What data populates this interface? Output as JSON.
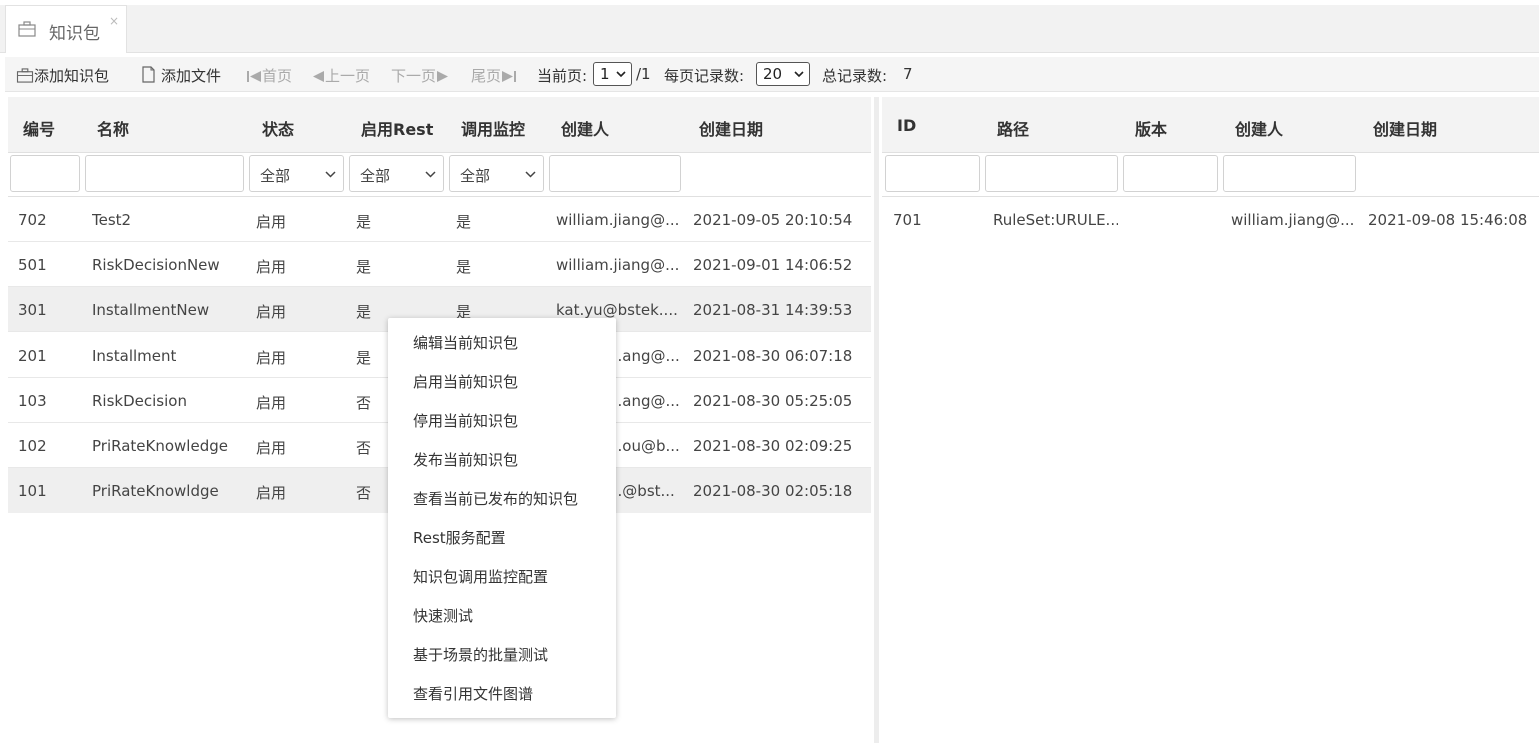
{
  "tab": {
    "title": "知识包",
    "close": "×",
    "icon": "briefcase-icon"
  },
  "toolbar": {
    "add_package": "添加知识包",
    "add_file": "添加文件",
    "first": "首页",
    "prev": "上一页",
    "next": "下一页",
    "last": "尾页",
    "current_page_label": "当前页:",
    "current_page": "1",
    "total_pages": "/1",
    "page_size_label": "每页记录数:",
    "page_size": "20",
    "total_label": "总记录数:",
    "total": "7"
  },
  "left_table": {
    "headers": [
      "编号",
      "名称",
      "状态",
      "启用Rest",
      "调用监控",
      "创建人",
      "创建日期"
    ],
    "filters": {
      "status": "全部",
      "rest": "全部",
      "monitor": "全部"
    },
    "rows": [
      [
        "702",
        "Test2",
        "启用",
        "是",
        "是",
        "william.jiang@...",
        "2021-09-05 20:10:54"
      ],
      [
        "501",
        "RiskDecisionNew",
        "启用",
        "是",
        "是",
        "william.jiang@...",
        "2021-09-01 14:06:52"
      ],
      [
        "301",
        "InstallmentNew",
        "启用",
        "是",
        "是",
        "kat.yu@bstek....",
        "2021-08-31 14:39:53"
      ],
      [
        "201",
        "Installment",
        "启用",
        "是",
        "",
        "...ang@...",
        "2021-08-30 06:07:18"
      ],
      [
        "103",
        "RiskDecision",
        "启用",
        "否",
        "",
        "...ang@...",
        "2021-08-30 05:25:05"
      ],
      [
        "102",
        "PriRateKnowledge",
        "启用",
        "否",
        "",
        "...ou@b...",
        "2021-08-30 02:09:25"
      ],
      [
        "101",
        "PriRateKnowldge",
        "启用",
        "否",
        "",
        "...@bst...",
        "2021-08-30 02:05:18"
      ]
    ]
  },
  "right_table": {
    "headers": [
      "ID",
      "路径",
      "版本",
      "创建人",
      "创建日期"
    ],
    "rows": [
      [
        "701",
        "RuleSet:URULE...",
        "",
        "william.jiang@...",
        "2021-09-08 15:46:08"
      ]
    ]
  },
  "context_menu": [
    "编辑当前知识包",
    "启用当前知识包",
    "停用当前知识包",
    "发布当前知识包",
    "查看当前已发布的知识包",
    "Rest服务配置",
    "知识包调用监控配置",
    "快速测试",
    "基于场景的批量测试",
    "查看引用文件图谱"
  ]
}
